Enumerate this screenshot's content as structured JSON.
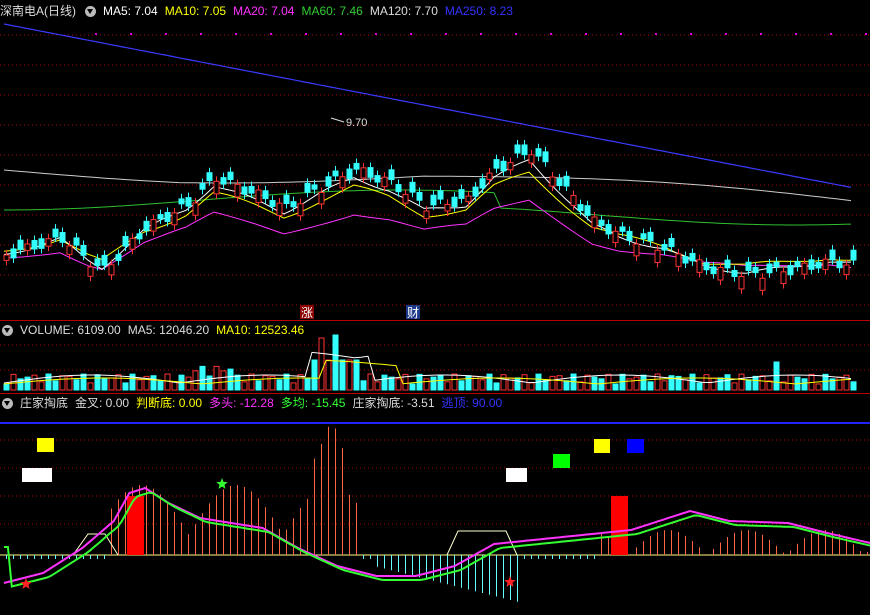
{
  "price_panel": {
    "title": "深南电A(日线)",
    "ma": [
      {
        "label": "MA5: 7.04",
        "color": "#ffffff"
      },
      {
        "label": "MA10: 7.05",
        "color": "#ffff00"
      },
      {
        "label": "MA20: 7.04",
        "color": "#ff33ff"
      },
      {
        "label": "MA60: 7.46",
        "color": "#33cc33"
      },
      {
        "label": "MA120: 7.70",
        "color": "#dddddd"
      },
      {
        "label": "MA250: 8.23",
        "color": "#3333ff"
      }
    ],
    "high_label": "9.70",
    "markers": [
      {
        "text": "涨",
        "bg": "#8b0000"
      },
      {
        "text": "财",
        "bg": "#1f3a8a"
      }
    ]
  },
  "volume_panel": {
    "items": [
      {
        "label": "VOLUME: 6109.00",
        "color": "#dddddd"
      },
      {
        "label": "MA5: 12046.20",
        "color": "#dddddd"
      },
      {
        "label": "MA10: 12523.46",
        "color": "#ffff00"
      }
    ]
  },
  "indicator_panel": {
    "items": [
      {
        "label": "庄家掏底",
        "color": "#dddddd"
      },
      {
        "label": "金叉: 0.00",
        "color": "#dddddd"
      },
      {
        "label": "判断底: 0.00",
        "color": "#ffff00"
      },
      {
        "label": "多头: -12.28",
        "color": "#ff33ff"
      },
      {
        "label": "多均: -15.45",
        "color": "#33ff33"
      },
      {
        "label": "庄家掏底: -3.51",
        "color": "#dddddd"
      },
      {
        "label": "逃顶: 90.00",
        "color": "#3333ff"
      }
    ]
  },
  "colors": {
    "up": "#ff3333",
    "down": "#33ffff",
    "grid": "#b00000"
  }
}
